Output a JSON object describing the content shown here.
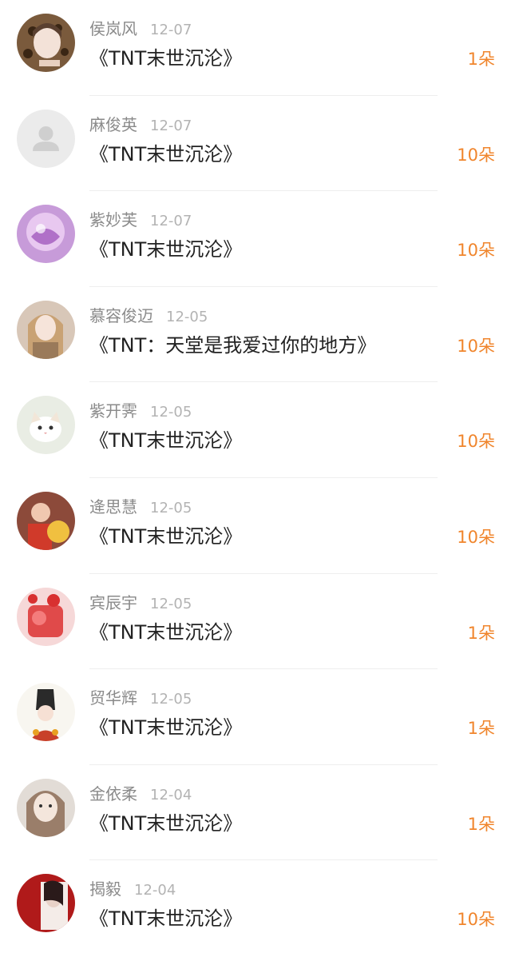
{
  "items": [
    {
      "name": "侯岚风",
      "date": "12-07",
      "title": "《TNT末世沉沦》",
      "count": "1朵",
      "avatar": "avatar-1"
    },
    {
      "name": "麻俊英",
      "date": "12-07",
      "title": "《TNT末世沉沦》",
      "count": "10朵",
      "avatar": "default-user-icon"
    },
    {
      "name": "紫妙芙",
      "date": "12-07",
      "title": "《TNT末世沉沦》",
      "count": "10朵",
      "avatar": "avatar-3"
    },
    {
      "name": "慕容俊迈",
      "date": "12-05",
      "title": "《TNT：天堂是我爱过你的地方》",
      "count": "10朵",
      "avatar": "avatar-4"
    },
    {
      "name": "紫开霁",
      "date": "12-05",
      "title": "《TNT末世沉沦》",
      "count": "10朵",
      "avatar": "avatar-5"
    },
    {
      "name": "逄思慧",
      "date": "12-05",
      "title": "《TNT末世沉沦》",
      "count": "10朵",
      "avatar": "avatar-6"
    },
    {
      "name": "宾辰宇",
      "date": "12-05",
      "title": "《TNT末世沉沦》",
      "count": "1朵",
      "avatar": "avatar-7"
    },
    {
      "name": "贸华辉",
      "date": "12-05",
      "title": "《TNT末世沉沦》",
      "count": "1朵",
      "avatar": "avatar-8"
    },
    {
      "name": "金依柔",
      "date": "12-04",
      "title": "《TNT末世沉沦》",
      "count": "1朵",
      "avatar": "avatar-9"
    },
    {
      "name": "揭毅",
      "date": "12-04",
      "title": "《TNT末世沉沦》",
      "count": "10朵",
      "avatar": "avatar-10"
    }
  ],
  "colors": {
    "accent": "#f0852c",
    "name_text": "#8a8a8a",
    "date_text": "#b3b3b3",
    "title_text": "#222222",
    "divider": "#eeeeee"
  }
}
